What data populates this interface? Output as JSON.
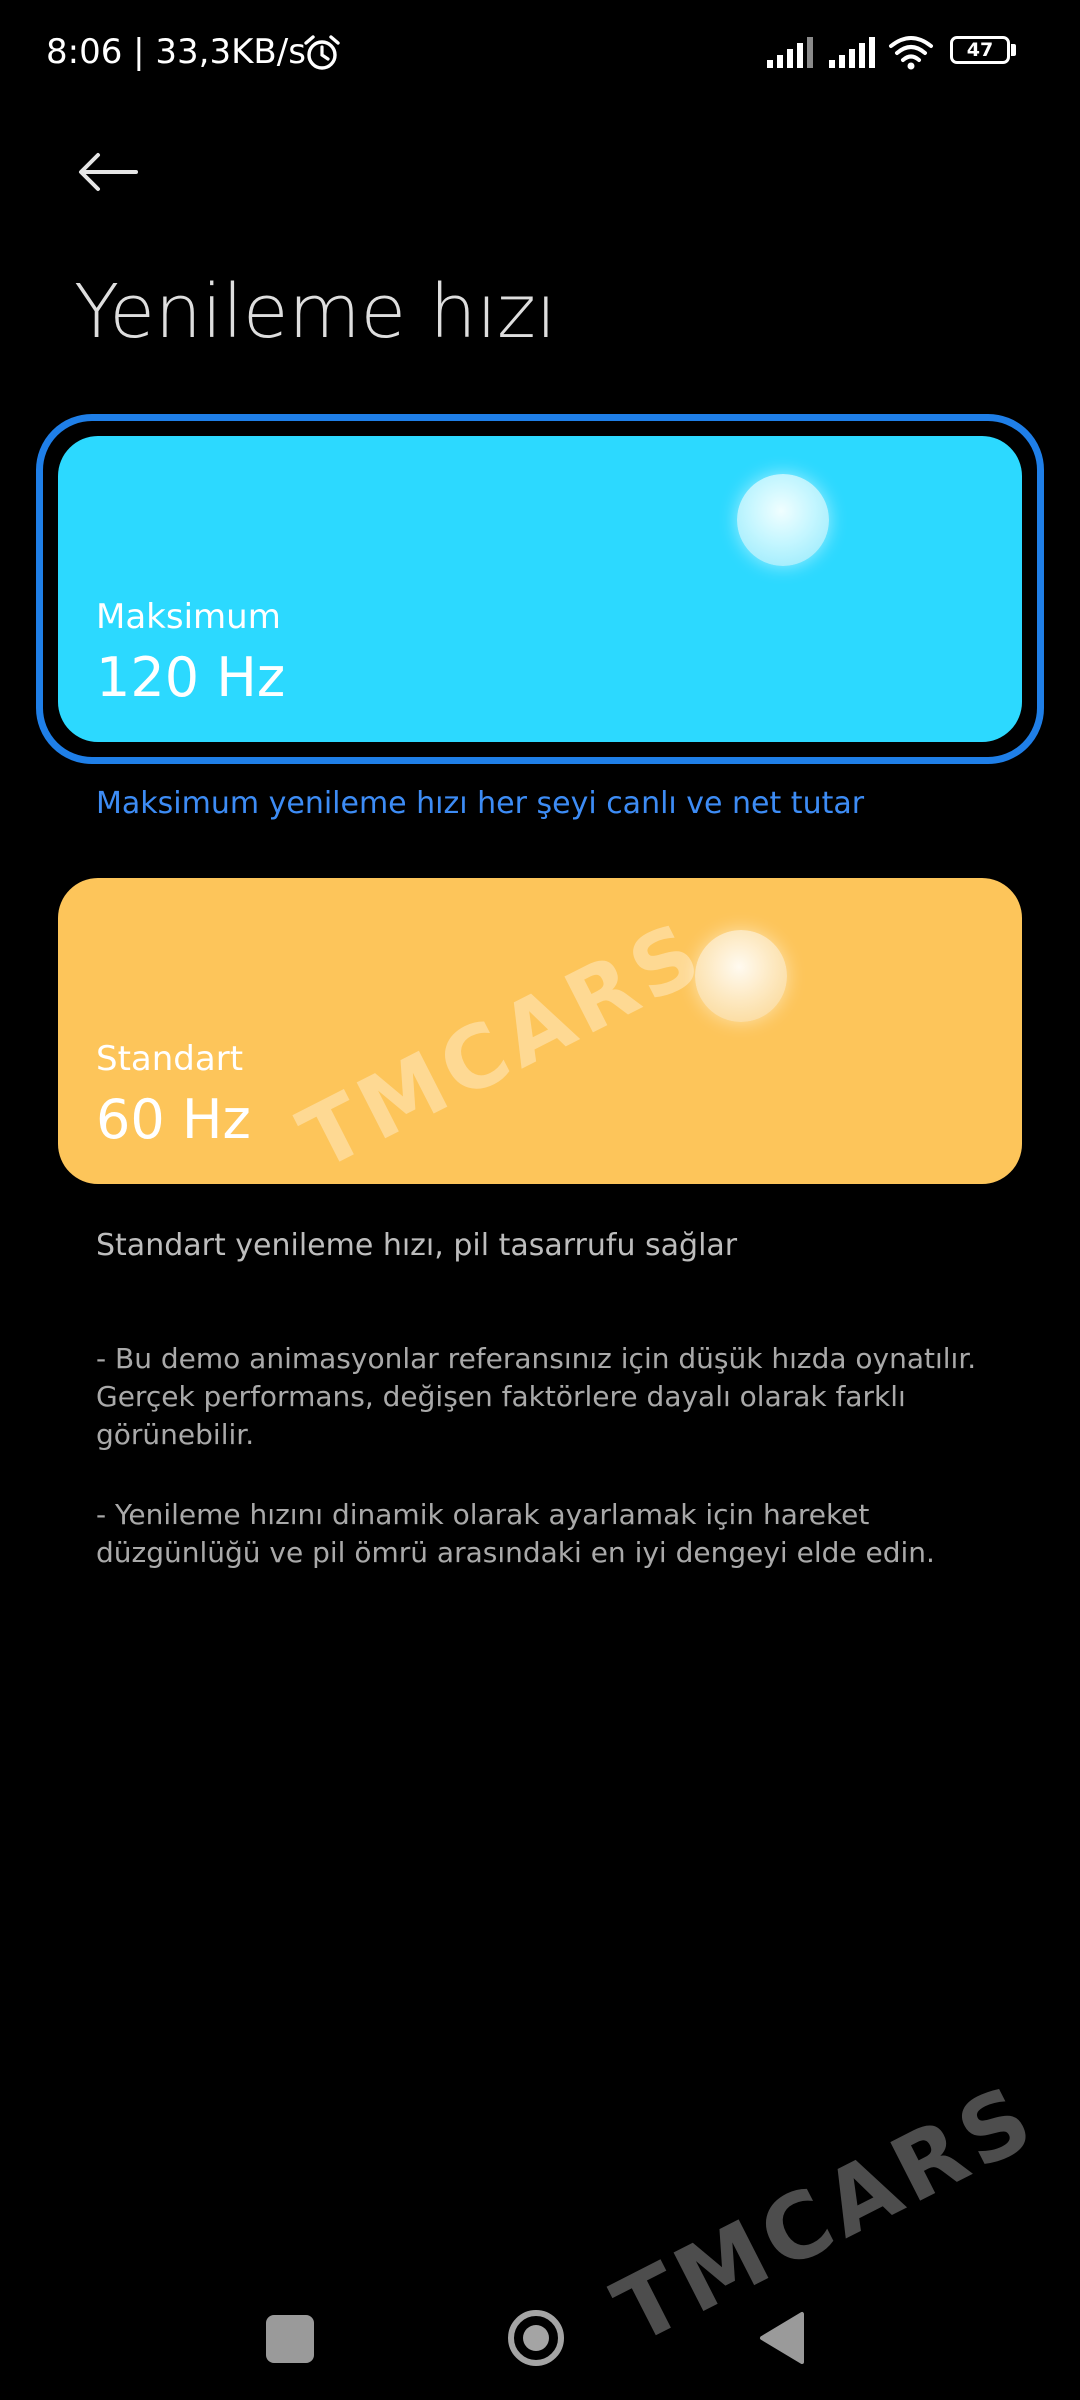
{
  "status_bar": {
    "time_speed": "8:06 | 33,3KB/s",
    "battery_level": "47",
    "icons": [
      "alarm-icon",
      "signal-icon",
      "signal-icon",
      "wifi-icon",
      "battery-icon"
    ]
  },
  "header": {
    "back_icon": "arrow-left-icon",
    "title": "Yenileme hızı"
  },
  "options": [
    {
      "label": "Maksimum",
      "value": "120 Hz",
      "description": "Maksimum yenileme hızı her şeyi canlı ve net tutar",
      "selected": true,
      "color": "#2cd9ff"
    },
    {
      "label": "Standart",
      "value": "60 Hz",
      "description": "Standart yenileme hızı, pil tasarrufu sağlar",
      "selected": false,
      "color": "#fdc55a"
    }
  ],
  "notes": [
    "- Bu demo animasyonlar referansınız için düşük hızda oynatılır. Gerçek performans, değişen faktörlere dayalı olarak farklı görünebilir.",
    "- Yenileme hızını dinamik olarak ayarlamak için hareket düzgünlüğü ve pil ömrü arasındaki en iyi dengeyi elde edin."
  ],
  "watermark": "TMCARS",
  "accent_color": "#1f7fe8",
  "nav_bar": {
    "icons": [
      "recents-square-icon",
      "home-circle-icon",
      "back-triangle-icon"
    ]
  }
}
